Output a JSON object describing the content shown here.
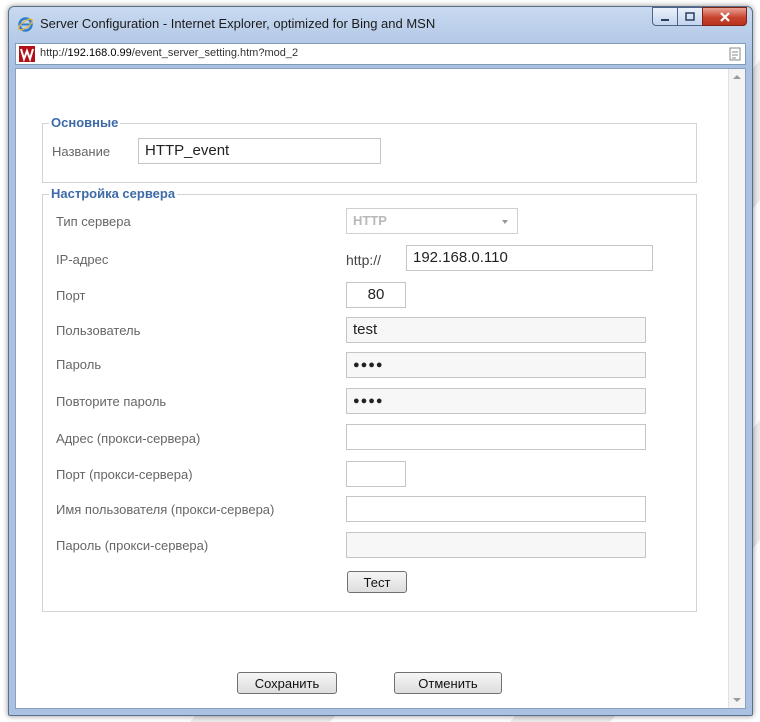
{
  "window": {
    "title": "Server Configuration - Internet Explorer, optimized for Bing and MSN",
    "url_prefix": "http://",
    "url_host": "192.168.0.99",
    "url_path": "/event_server_setting.htm?mod_2"
  },
  "basic": {
    "legend": "Основные",
    "name_label": "Название",
    "name_value": "HTTP_event"
  },
  "server": {
    "legend": "Настройка сервера",
    "type_label": "Тип сервера",
    "type_value": "HTTP",
    "ip_label": "IP-адрес",
    "ip_prefix": "http://",
    "ip_value": "192.168.0.110",
    "port_label": "Порт",
    "port_value": "80",
    "user_label": "Пользователь",
    "user_value": "test",
    "password_label": "Пароль",
    "password_value": "●●●●",
    "repeat_label": "Повторите пароль",
    "repeat_value": "●●●●",
    "proxy_addr_label": "Адрес (прокси-сервера)",
    "proxy_addr_value": "",
    "proxy_port_label": "Порт (прокси-сервера)",
    "proxy_port_value": "",
    "proxy_user_label": "Имя пользователя (прокси-сервера)",
    "proxy_user_value": "",
    "proxy_pass_label": "Пароль (прокси-сервера)",
    "proxy_pass_value": "",
    "test_button": "Тест"
  },
  "actions": {
    "save": "Сохранить",
    "cancel": "Отменить"
  },
  "colors": {
    "legend": "#3e6aa8",
    "label": "#666666"
  }
}
